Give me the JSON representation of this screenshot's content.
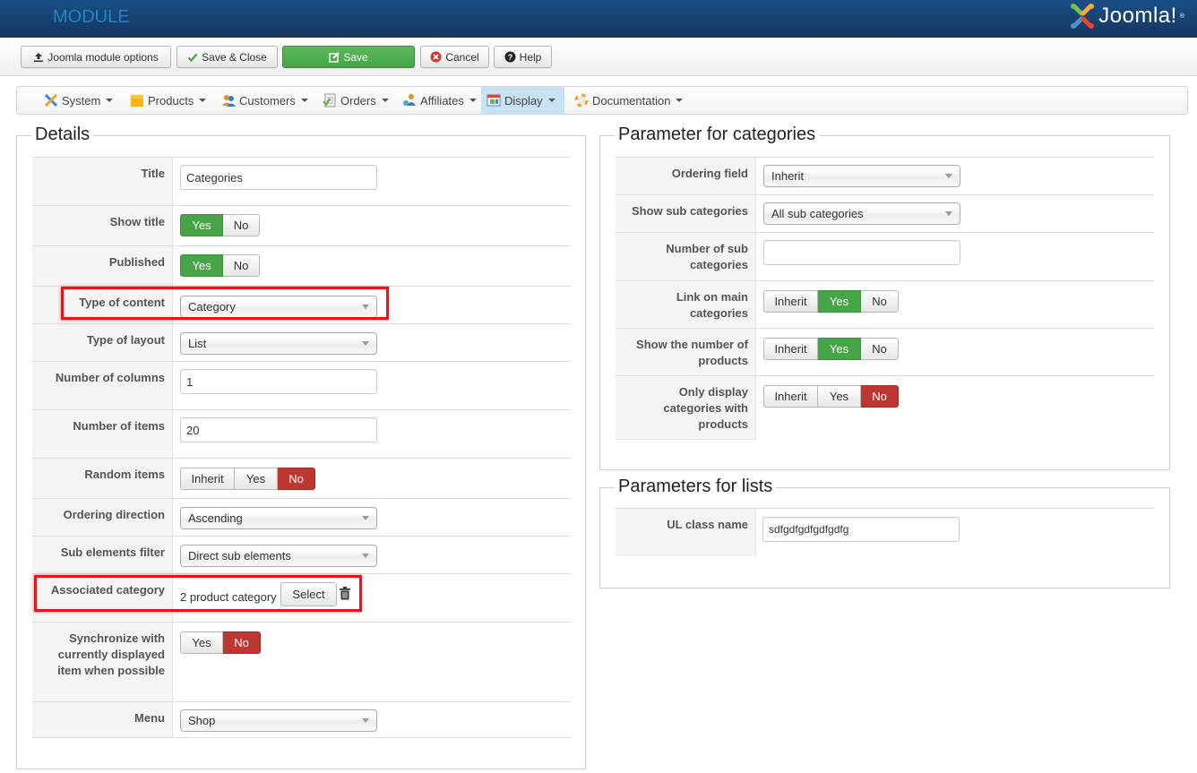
{
  "header": {
    "title": "MODULE",
    "logo_text": "Joomla!",
    "logo_mark": "®"
  },
  "toolbar": {
    "buttons": [
      {
        "label": "Joomla module options",
        "icon": "upload-icon"
      },
      {
        "label": "Save & Close",
        "icon": "check-icon"
      },
      {
        "label": "Save",
        "icon": "edit-icon"
      },
      {
        "label": "Cancel",
        "icon": "cancel-circle-icon"
      },
      {
        "label": "Help",
        "icon": "question-circle-icon"
      }
    ]
  },
  "nav": {
    "items": [
      {
        "label": "System",
        "icon": "tools-icon"
      },
      {
        "label": "Products",
        "icon": "folder-icon"
      },
      {
        "label": "Customers",
        "icon": "users-icon"
      },
      {
        "label": "Orders",
        "icon": "document-check-icon"
      },
      {
        "label": "Affiliates",
        "icon": "affiliates-icon"
      },
      {
        "label": "Display",
        "icon": "display-window-icon",
        "active": true
      },
      {
        "label": "Documentation",
        "icon": "lifebuoy-icon"
      }
    ]
  },
  "details": {
    "legend": "Details",
    "title_label": "Title",
    "title_value": "Categories",
    "show_title_label": "Show title",
    "published_label": "Published",
    "type_content_label": "Type of content",
    "type_content_value": "Category",
    "type_layout_label": "Type of layout",
    "type_layout_value": "List",
    "num_columns_label": "Number of columns",
    "num_columns_value": "1",
    "num_items_label": "Number of items",
    "num_items_value": "20",
    "random_items_label": "Random items",
    "ordering_direction_label": "Ordering direction",
    "ordering_direction_value": "Ascending",
    "sub_filter_label": "Sub elements filter",
    "sub_filter_value": "Direct sub elements",
    "assoc_category_label": "Associated category",
    "assoc_category_value": "2 product category",
    "assoc_select_label": "Select",
    "sync_label": "Synchronize with currently displayed item when possible",
    "menu_label": "Menu",
    "menu_value": "Shop"
  },
  "toggles": {
    "yes": "Yes",
    "no": "No",
    "inherit": "Inherit",
    "show_title": "Yes",
    "published": "Yes",
    "random_items": "No",
    "sync": "No",
    "link_main": "Yes",
    "show_number": "Yes",
    "only_display": "No"
  },
  "categories_params": {
    "legend": "Parameter for categories",
    "ordering_field_label": "Ordering field",
    "ordering_field_value": "Inherit",
    "show_sub_label": "Show sub categories",
    "show_sub_value": "All sub categories",
    "num_sub_label": "Number of sub categories",
    "num_sub_value": "",
    "link_main_label": "Link on main categories",
    "show_number_label": "Show the number of products",
    "only_display_label": "Only display categories with products"
  },
  "lists_params": {
    "legend": "Parameters for lists",
    "ul_class_label": "UL class name",
    "ul_class_value": "sdfgdfgdfgdfgdfg"
  },
  "colors": {
    "header_bg": "#17406e",
    "success": "#46a546",
    "danger": "#bd362f",
    "highlight": "#e8141a",
    "nav_active": "#c7e2f5"
  }
}
